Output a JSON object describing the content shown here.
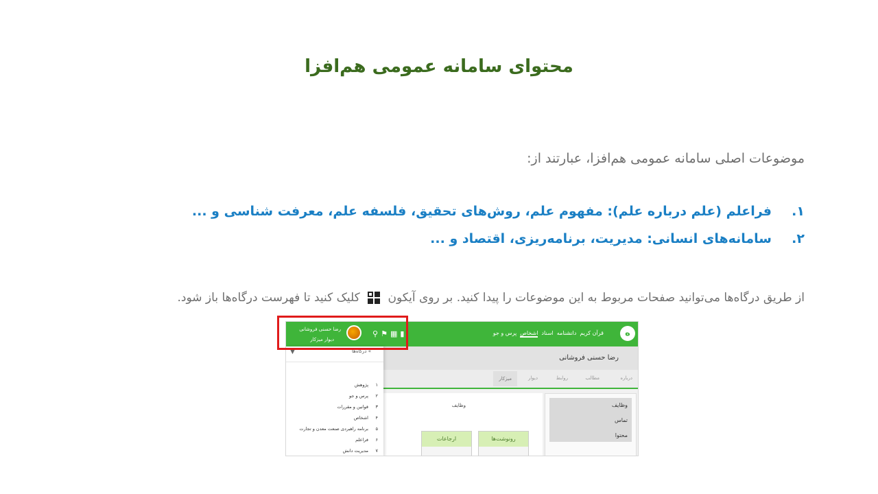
{
  "title": "محتوای سامانه عمومی هم‌افزا",
  "intro": "موضوعات اصلی سامانه عمومی هم‌افزا، عبارتند از:",
  "topics": [
    {
      "num": "۱.",
      "text": "فراعلم (علم درباره علم): مفهوم علم، روش‌های تحقیق، فلسفه علم، معرفت شناسی و ..."
    },
    {
      "num": "۲.",
      "text": "سامانه‌های انسانی: مدیریت، برنامه‌ریزی، اقتصاد و ..."
    }
  ],
  "portal_text_before": "از طریق درگاه‌ها می‌توانید صفحات مربوط به این موضوعات را پیدا کنید. بر روی آیکون",
  "portal_text_after": "کلیک کنید تا فهرست درگاه‌ها باز شود.",
  "portal_icon": "portal-grid-icon",
  "screenshot": {
    "nav": [
      "قرآن کریم",
      "دانشنامه",
      "اسناد",
      "اشخاص",
      "پرس و جو"
    ],
    "active_nav": "اشخاص",
    "user_name": "رضا حسنی فروشانی",
    "user_wall": "دیوار میزکار",
    "profile_name": "رضا حسنی فروشانی",
    "tabs": [
      "درباره",
      "مطالب",
      "روابط",
      "دیوار",
      "میزکار"
    ],
    "active_tab": "میزکار",
    "side_items": [
      "وظایف",
      "تماس",
      "محتوا"
    ],
    "duties_label": "وظایف",
    "cards": [
      "رونوشت‌ها",
      "ارجاعات"
    ],
    "portals_title": "درگاه‌ها",
    "portals": [
      {
        "n": "۱",
        "label": "پژوهش"
      },
      {
        "n": "۲",
        "label": "پرس و جو"
      },
      {
        "n": "۳",
        "label": "قوانین و مقررات"
      },
      {
        "n": "۴",
        "label": "اشخاص"
      },
      {
        "n": "۵",
        "label": "برنامه راهبردی صنعت معدن و تجارت"
      },
      {
        "n": "۶",
        "label": "فراعلم"
      },
      {
        "n": "۷",
        "label": "مدیریت دانش"
      }
    ]
  },
  "colors": {
    "title": "#3b6b1e",
    "list": "#1a7fc4",
    "green_bar": "#3fb53a",
    "highlight": "#e01b1b"
  }
}
